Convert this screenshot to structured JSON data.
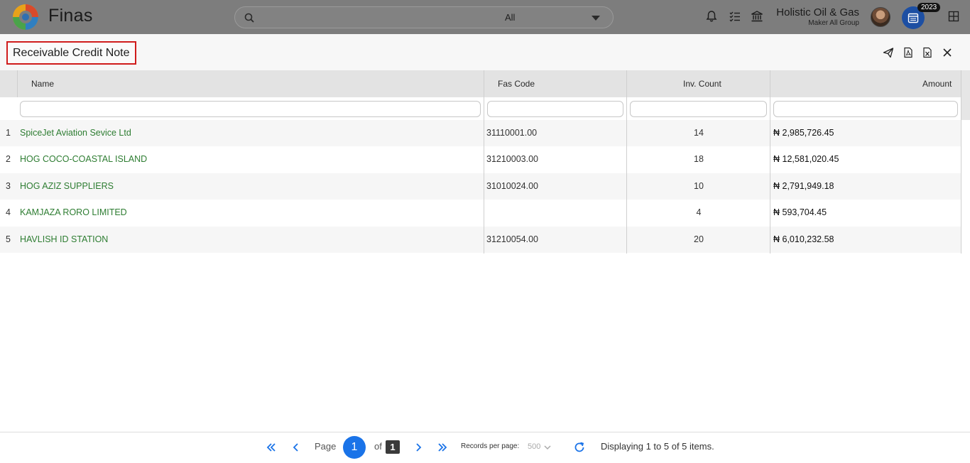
{
  "app": {
    "brand": "Finas"
  },
  "search": {
    "scope": "All"
  },
  "company": {
    "name": "Holistic Oil & Gas",
    "role": "Maker All Group"
  },
  "year_badge": "2023",
  "page": {
    "title": "Receivable Credit Note"
  },
  "table": {
    "columns": [
      "Name",
      "Fas Code",
      "Inv. Count",
      "Amount"
    ],
    "rows": [
      {
        "num": "1",
        "name": "SpiceJet Aviation Sevice Ltd",
        "code": "31110001.00",
        "count": "14",
        "amount": "₦ 2,985,726.45"
      },
      {
        "num": "2",
        "name": "HOG COCO-COASTAL ISLAND",
        "code": "31210003.00",
        "count": "18",
        "amount": "₦ 12,581,020.45"
      },
      {
        "num": "3",
        "name": "HOG AZIZ SUPPLIERS",
        "code": "31010024.00",
        "count": "10",
        "amount": "₦ 2,791,949.18"
      },
      {
        "num": "4",
        "name": "KAMJAZA RORO LIMITED",
        "code": "",
        "count": "4",
        "amount": "₦ 593,704.45"
      },
      {
        "num": "5",
        "name": "HAVLISH ID STATION",
        "code": "31210054.00",
        "count": "20",
        "amount": "₦ 6,010,232.58"
      }
    ]
  },
  "pager": {
    "page_label": "Page",
    "current": "1",
    "of_label": "of",
    "total": "1",
    "rpp_label": "Records per page:",
    "rpp_value": "500",
    "status": "Displaying 1 to 5 of 5 items."
  },
  "colors": {
    "accent": "#1a73e8",
    "name_link": "#2e7d32",
    "title_border": "#d01c1c",
    "topbar": "#7d7d7d"
  }
}
